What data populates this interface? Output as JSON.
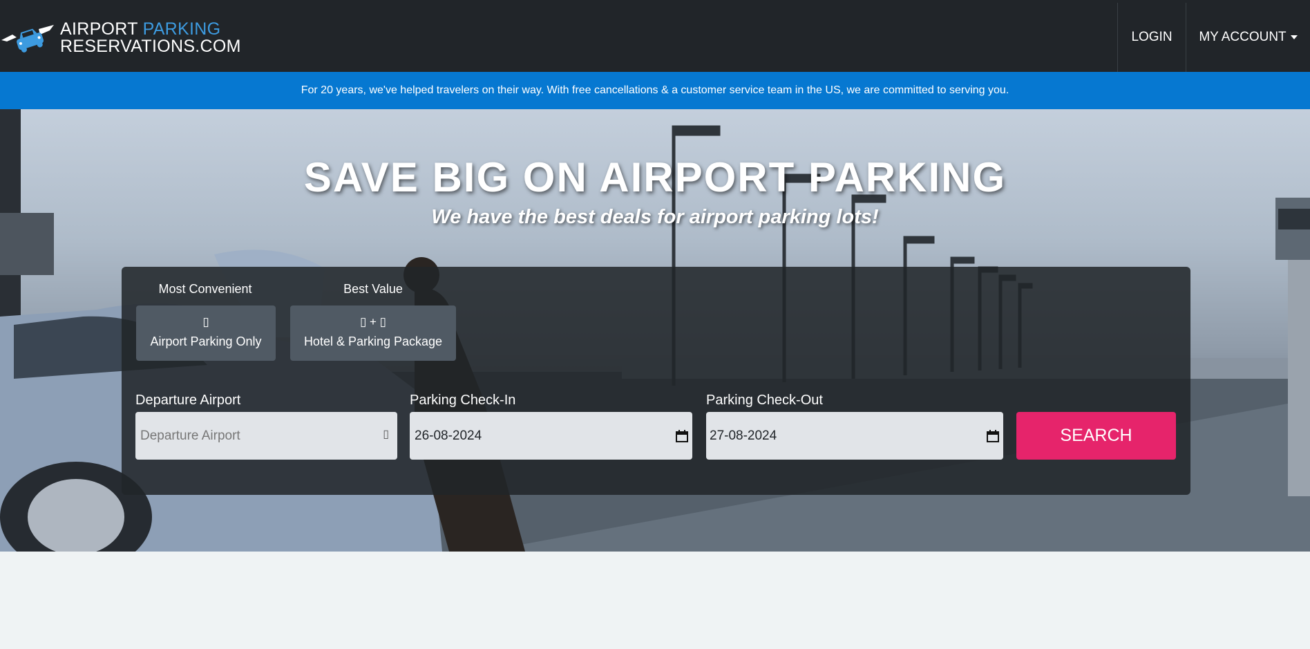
{
  "header": {
    "logo": {
      "line1_a": "AIRPORT",
      "line1_b": "PARKING",
      "line2": "RESERVATIONS.COM"
    },
    "nav": {
      "login": "LOGIN",
      "account": "MY ACCOUNT"
    }
  },
  "banner": {
    "text": "For 20 years, we've helped travelers on their way. With free cancellations & a customer service team in the US, we are committed to serving you."
  },
  "hero": {
    "title": "SAVE BIG ON AIRPORT PARKING",
    "subtitle": "We have the best deals for airport parking lots!"
  },
  "search": {
    "options": [
      {
        "tag": "Most Convenient",
        "icons": "▯",
        "label": "Airport Parking Only"
      },
      {
        "tag": "Best Value",
        "icons": "▯ + ▯",
        "label": "Hotel & Parking Package"
      }
    ],
    "fields": {
      "departure": {
        "label": "Departure Airport",
        "placeholder": "Departure Airport",
        "value": ""
      },
      "checkin": {
        "label": "Parking Check-In",
        "value": "26-08-2024"
      },
      "checkout": {
        "label": "Parking Check-Out",
        "value": "27-08-2024"
      }
    },
    "button": "SEARCH"
  },
  "icons": {
    "car": "car-icon",
    "calendar": "calendar-icon",
    "location": "location-icon"
  },
  "colors": {
    "header": "#212529",
    "banner": "#0678d1",
    "accent": "#3d9be0",
    "search_button": "#e6246b"
  }
}
